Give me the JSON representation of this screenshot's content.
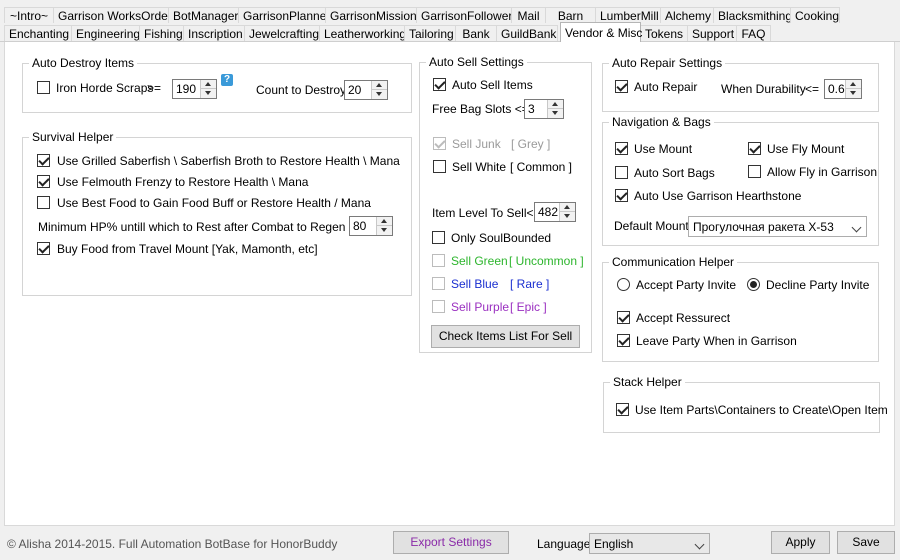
{
  "tabs_row1": [
    "~Intro~",
    "Garrison WorksOrders",
    "BotManager",
    "GarrisonPlanner",
    "GarrisonMissions",
    "GarrisonFollowers",
    "Mail",
    "Barn",
    "LumberMill",
    "Alchemy",
    "Blacksmithing",
    "Cooking"
  ],
  "tabs_row2": [
    "Enchanting",
    "Engineering",
    "Fishing",
    "Inscription",
    "Jewelcrafting",
    "Leatherworking",
    "Tailoring",
    "Bank",
    "GuildBank",
    "Vendor & Misc",
    "Tokens",
    "Support",
    "FAQ"
  ],
  "auto_destroy": {
    "title": "Auto Destroy Items",
    "scraps_label": "Iron Horde Scraps",
    "op": ">=",
    "scraps_value": "190",
    "help": "?",
    "count_label": "Count to Destroy",
    "count_value": "20"
  },
  "survival": {
    "title": "Survival Helper",
    "opt1": "Use Grilled Saberfish \\ Saberfish Broth to Restore Health \\ Mana",
    "opt2": "Use Felmouth Frenzy to Restore Health \\ Mana",
    "opt3": "Use Best Food to Gain Food Buff or Restore Health / Mana",
    "min_hp_label": "Minimum HP% untill which to Rest after Combat to Regen HP/MP",
    "min_hp_value": "80",
    "opt4": "Buy Food from Travel Mount [Yak, Mamonth, etc]"
  },
  "auto_sell": {
    "title": "Auto Sell Settings",
    "auto_sell": "Auto Sell Items",
    "free_slots_label": "Free Bag Slots <=",
    "free_slots_value": "3",
    "sell_junk": "Sell Junk",
    "junk_tag": "[ Grey ]",
    "sell_white": "Sell White",
    "white_tag": "[ Common ]",
    "ilvl_label": "Item Level To Sell<=",
    "ilvl_value": "482",
    "soulbound": "Only SoulBounded",
    "sell_green": "Sell Green",
    "green_tag": "[ Uncommon ]",
    "sell_blue": "Sell Blue",
    "blue_tag": "[ Rare ]",
    "sell_purple": "Sell Purple",
    "purple_tag": "[ Epic ]",
    "check_btn": "Check Items List For Sell"
  },
  "auto_repair": {
    "title": "Auto Repair Settings",
    "auto_repair": "Auto Repair",
    "durability_label": "When Durability",
    "op": "<=",
    "durability_value": "0.6"
  },
  "navigation": {
    "title": "Navigation & Bags",
    "use_mount": "Use Mount",
    "use_fly": "Use Fly Mount",
    "auto_sort": "Auto Sort Bags",
    "allow_fly": "Allow Fly in Garrison",
    "hearthstone": "Auto Use Garrison Hearthstone",
    "default_mount_label": "Default Mount:",
    "default_mount_value": "Прогулочная ракета X-53"
  },
  "communication": {
    "title": "Communication Helper",
    "accept_party": "Accept Party Invite",
    "decline_party": "Decline Party Invite",
    "accept_res": "Accept Ressurect",
    "leave_party": "Leave Party When in Garrison"
  },
  "stack": {
    "title": "Stack Helper",
    "use_parts": "Use Item Parts\\Containers to Create\\Open Item"
  },
  "footer": {
    "copyright": "© Alisha 2014-2015. Full Automation BotBase for HonorBuddy",
    "export": "Export Settings",
    "language_label": "Language",
    "language_value": "English",
    "apply": "Apply",
    "save": "Save"
  },
  "colors": {
    "green": "#2db52d",
    "blue": "#1a2fd0",
    "purple": "#9a2fc0",
    "grey": "#9a9a9a",
    "export_text": "#8a2ba8"
  }
}
